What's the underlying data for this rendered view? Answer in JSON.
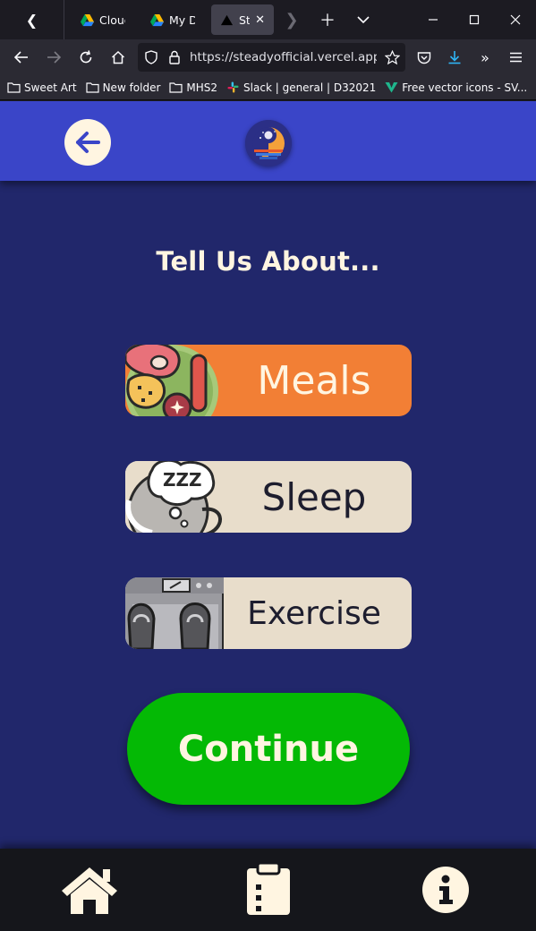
{
  "browser": {
    "tabs": [
      {
        "label": "Cloud",
        "active": false
      },
      {
        "label": "My Dr",
        "active": false
      },
      {
        "label": "Ste",
        "active": true
      }
    ],
    "url": "https://steadyofficial.vercel.app/",
    "bookmarks": [
      {
        "label": "Sweet Art"
      },
      {
        "label": "New folder"
      },
      {
        "label": "MHS2"
      },
      {
        "label": "Slack | general | D32021"
      },
      {
        "label": "Free vector icons - SV..."
      }
    ]
  },
  "app": {
    "heading": "Tell Us About...",
    "topics": [
      {
        "label": "Meals",
        "icon": "meal-plate-icon"
      },
      {
        "label": "Sleep",
        "icon": "sleep-zzz-icon"
      },
      {
        "label": "Exercise",
        "icon": "scale-feet-icon"
      }
    ],
    "continue_label": "Continue",
    "bottom_nav": [
      {
        "icon": "home-icon"
      },
      {
        "icon": "clipboard-icon"
      },
      {
        "icon": "info-icon"
      }
    ]
  },
  "colors": {
    "header": "#3a45c8",
    "page_bg": "#21276b",
    "meals": "#f27f35",
    "sleep": "#e8ddcb",
    "exercise": "#e8ddcb",
    "continue": "#04b905",
    "cream": "#fff5e1",
    "bottom_bar": "#15161b"
  }
}
